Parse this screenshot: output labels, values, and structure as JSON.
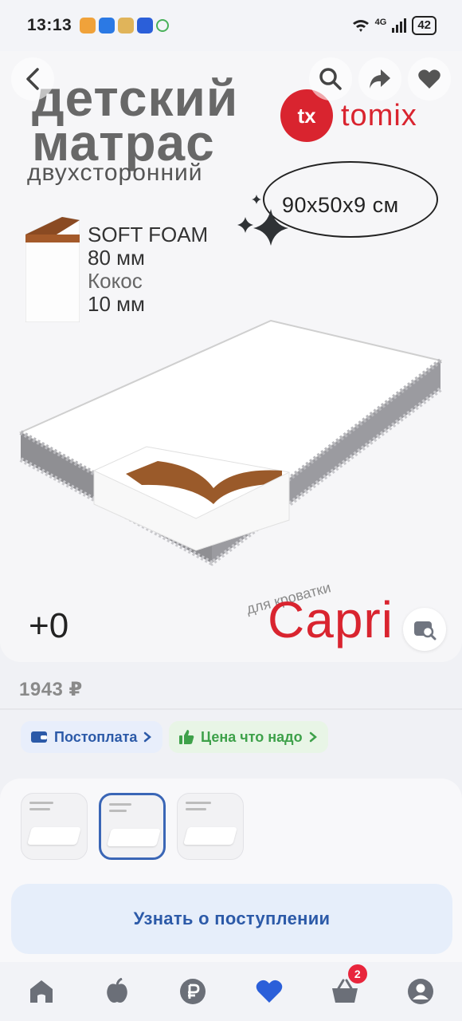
{
  "status_bar": {
    "time": "13:13",
    "signal_text": "4G",
    "battery": "42"
  },
  "product_image": {
    "title_line1": "детский",
    "title_line2": "матрас",
    "subtitle": "двухсторонний",
    "brand_mark": "tx",
    "brand_name": "tomix",
    "dimensions": "90x50x9 см",
    "layers": [
      {
        "name": "SOFT FOAM",
        "thickness": "80 мм"
      },
      {
        "name": "Кокос",
        "thickness": "10 мм"
      }
    ],
    "plus_count": "+0",
    "series_prefix": "для кроватки",
    "series_name": "Capri"
  },
  "price": "1943 ₽",
  "chips": [
    {
      "label": "Постоплата",
      "color": "#2c5aa8"
    },
    {
      "label": "Цена что надо",
      "color": "#3ea14a"
    }
  ],
  "thumbnails": {
    "count": 3,
    "selected_index": 1
  },
  "notify_button": {
    "label": "Узнать о поступлении"
  },
  "bottom_nav": {
    "items": [
      "home-icon",
      "catalog-apple-icon",
      "ruble-icon",
      "heart-icon",
      "cart-icon",
      "profile-icon"
    ],
    "cart_badge": "2",
    "active": "heart-icon"
  },
  "colors": {
    "accent_blue": "#2c5aa8",
    "brand_red": "#d9242f",
    "nav_active": "#2b5fd9",
    "nav_inactive": "#6b6f78"
  }
}
